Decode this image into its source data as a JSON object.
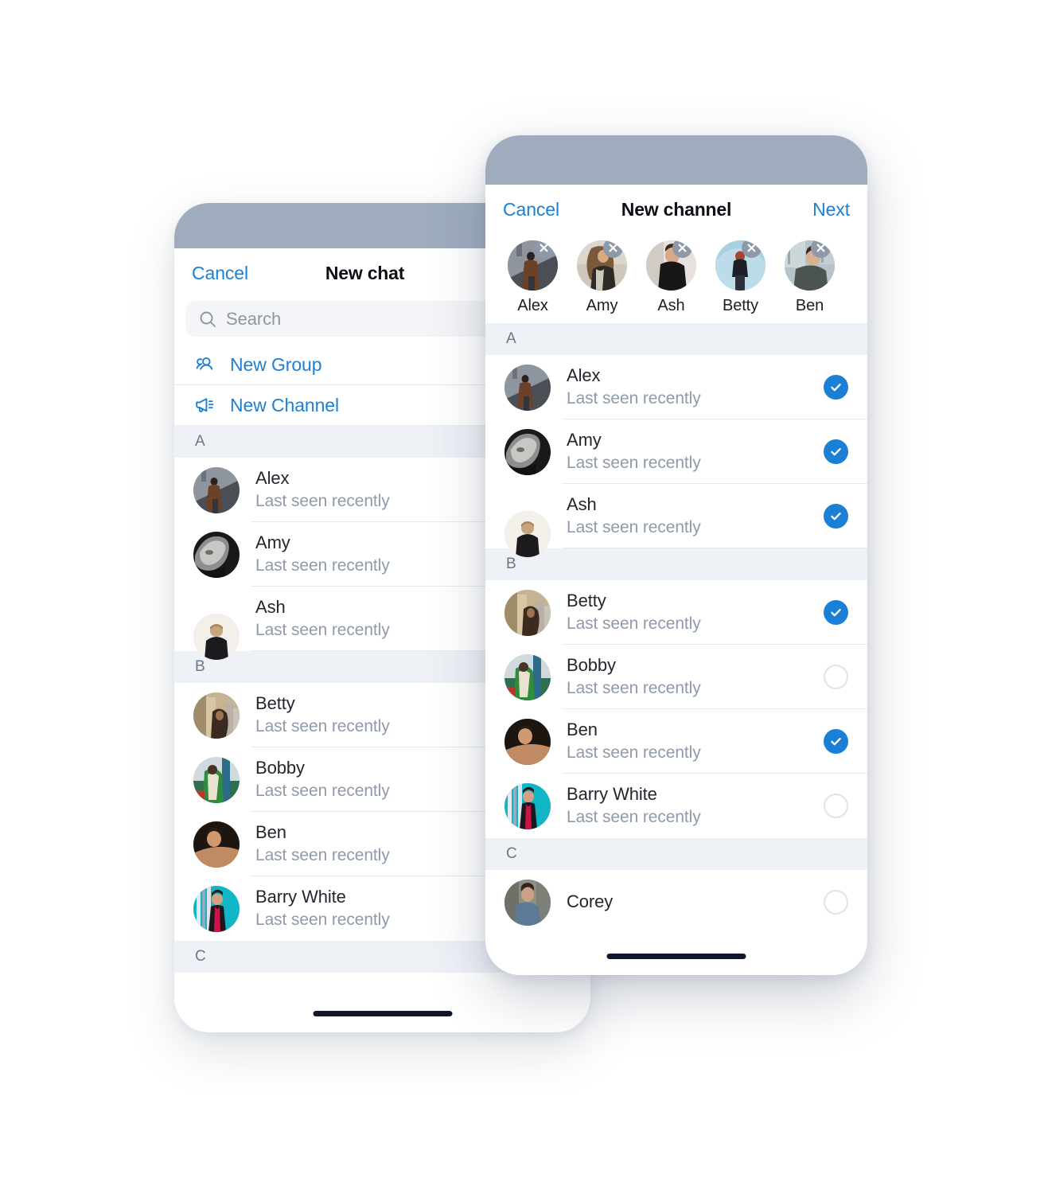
{
  "theme": {
    "accent_blue": "#1c7fd6",
    "status_bar": "#9eacbe",
    "section_bg": "#eef1f6",
    "chip_close_bg": "#8e99a8",
    "secondary_text": "#8f9aaa"
  },
  "back_screen": {
    "nav": {
      "cancel_label": "Cancel",
      "title": "New chat"
    },
    "search": {
      "placeholder": "Search",
      "icon": "search-icon"
    },
    "actions": [
      {
        "label": "New Group",
        "icon": "group-people-icon"
      },
      {
        "label": "New Channel",
        "icon": "megaphone-icon"
      }
    ],
    "sections": [
      {
        "letter": "A",
        "contacts": [
          {
            "name": "Alex",
            "status": "Last seen recently"
          },
          {
            "name": "Amy",
            "status": "Last seen recently"
          },
          {
            "name": "Ash",
            "status": "Last seen recently"
          }
        ]
      },
      {
        "letter": "B",
        "contacts": [
          {
            "name": "Betty",
            "status": "Last seen recently"
          },
          {
            "name": "Bobby",
            "status": "Last seen recently"
          },
          {
            "name": "Ben",
            "status": "Last seen recently"
          },
          {
            "name": "Barry White",
            "status": "Last seen recently"
          }
        ]
      },
      {
        "letter": "C",
        "contacts": []
      }
    ]
  },
  "front_screen": {
    "nav": {
      "cancel_label": "Cancel",
      "title": "New channel",
      "next_label": "Next"
    },
    "selected_chips": [
      {
        "name": "Alex",
        "remove_icon": "close-icon"
      },
      {
        "name": "Amy",
        "remove_icon": "close-icon"
      },
      {
        "name": "Ash",
        "remove_icon": "close-icon"
      },
      {
        "name": "Betty",
        "remove_icon": "close-icon"
      },
      {
        "name": "Ben",
        "remove_icon": "close-icon"
      }
    ],
    "sections": [
      {
        "letter": "A",
        "contacts": [
          {
            "name": "Alex",
            "status": "Last seen recently",
            "selected": true
          },
          {
            "name": "Amy",
            "status": "Last seen recently",
            "selected": true
          },
          {
            "name": "Ash",
            "status": "Last seen recently",
            "selected": true
          }
        ]
      },
      {
        "letter": "B",
        "contacts": [
          {
            "name": "Betty",
            "status": "Last seen recently",
            "selected": true
          },
          {
            "name": "Bobby",
            "status": "Last seen recently",
            "selected": false
          },
          {
            "name": "Ben",
            "status": "Last seen recently",
            "selected": true
          },
          {
            "name": "Barry White",
            "status": "Last seen recently",
            "selected": false
          }
        ]
      },
      {
        "letter": "C",
        "contacts": [
          {
            "name": "Corey",
            "status": "",
            "selected": false
          }
        ]
      }
    ]
  }
}
